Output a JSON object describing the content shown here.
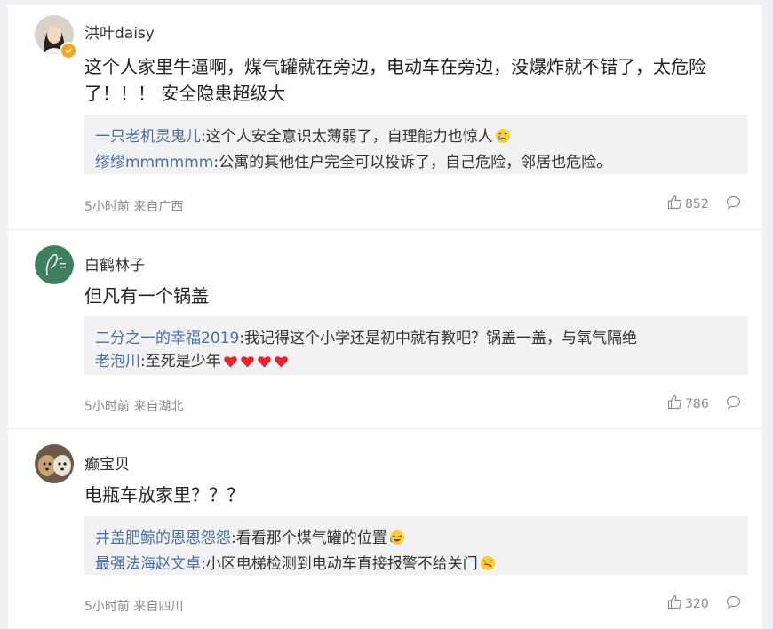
{
  "comments": [
    {
      "username": "洪叶daisy",
      "avatar": "photo-of-woman",
      "verified": true,
      "content": "这个人家里牛逼啊，煤气罐就在旁边，电动车在旁边，没爆炸就不错了，太危险了！！！ 安全隐患超级大",
      "replies": [
        {
          "user": "一只老机灵鬼儿",
          "text": ":这个人安全意识太薄弱了，自理能力也惊人",
          "emoji": "crying-face"
        },
        {
          "user": "缪缪mmmmmm",
          "text": ":公寓的其他住户完全可以投诉了，自己危险，邻居也危险。"
        }
      ],
      "meta": "5小时前 来自广西",
      "likes": "852"
    },
    {
      "username": "白鹤林子",
      "avatar": "crane-logo",
      "content": "但凡有一个锅盖",
      "replies": [
        {
          "user": "二分之一的幸福2019",
          "text": ":我记得这个小学还是初中就有教吧？锅盖一盖，与氧气隔绝"
        },
        {
          "user": "老泡川",
          "text": ":至死是少年",
          "hearts": 4
        }
      ],
      "meta": "5小时前 来自湖北",
      "likes": "786"
    },
    {
      "username": "癫宝贝",
      "avatar": "puppy-photo",
      "content": "电瓶车放家里？？？",
      "replies": [
        {
          "user": "井盖肥鲸的恩恩怨怨",
          "text": ":看看那个煤气罐的位置",
          "emoji": "laughing-face"
        },
        {
          "user": "最强法海赵文卓",
          "text": ":小区电梯检测到电动车直接报警不给关门",
          "emoji": "smirk-face"
        }
      ],
      "meta": "5小时前 来自四川",
      "likes": "320"
    }
  ]
}
